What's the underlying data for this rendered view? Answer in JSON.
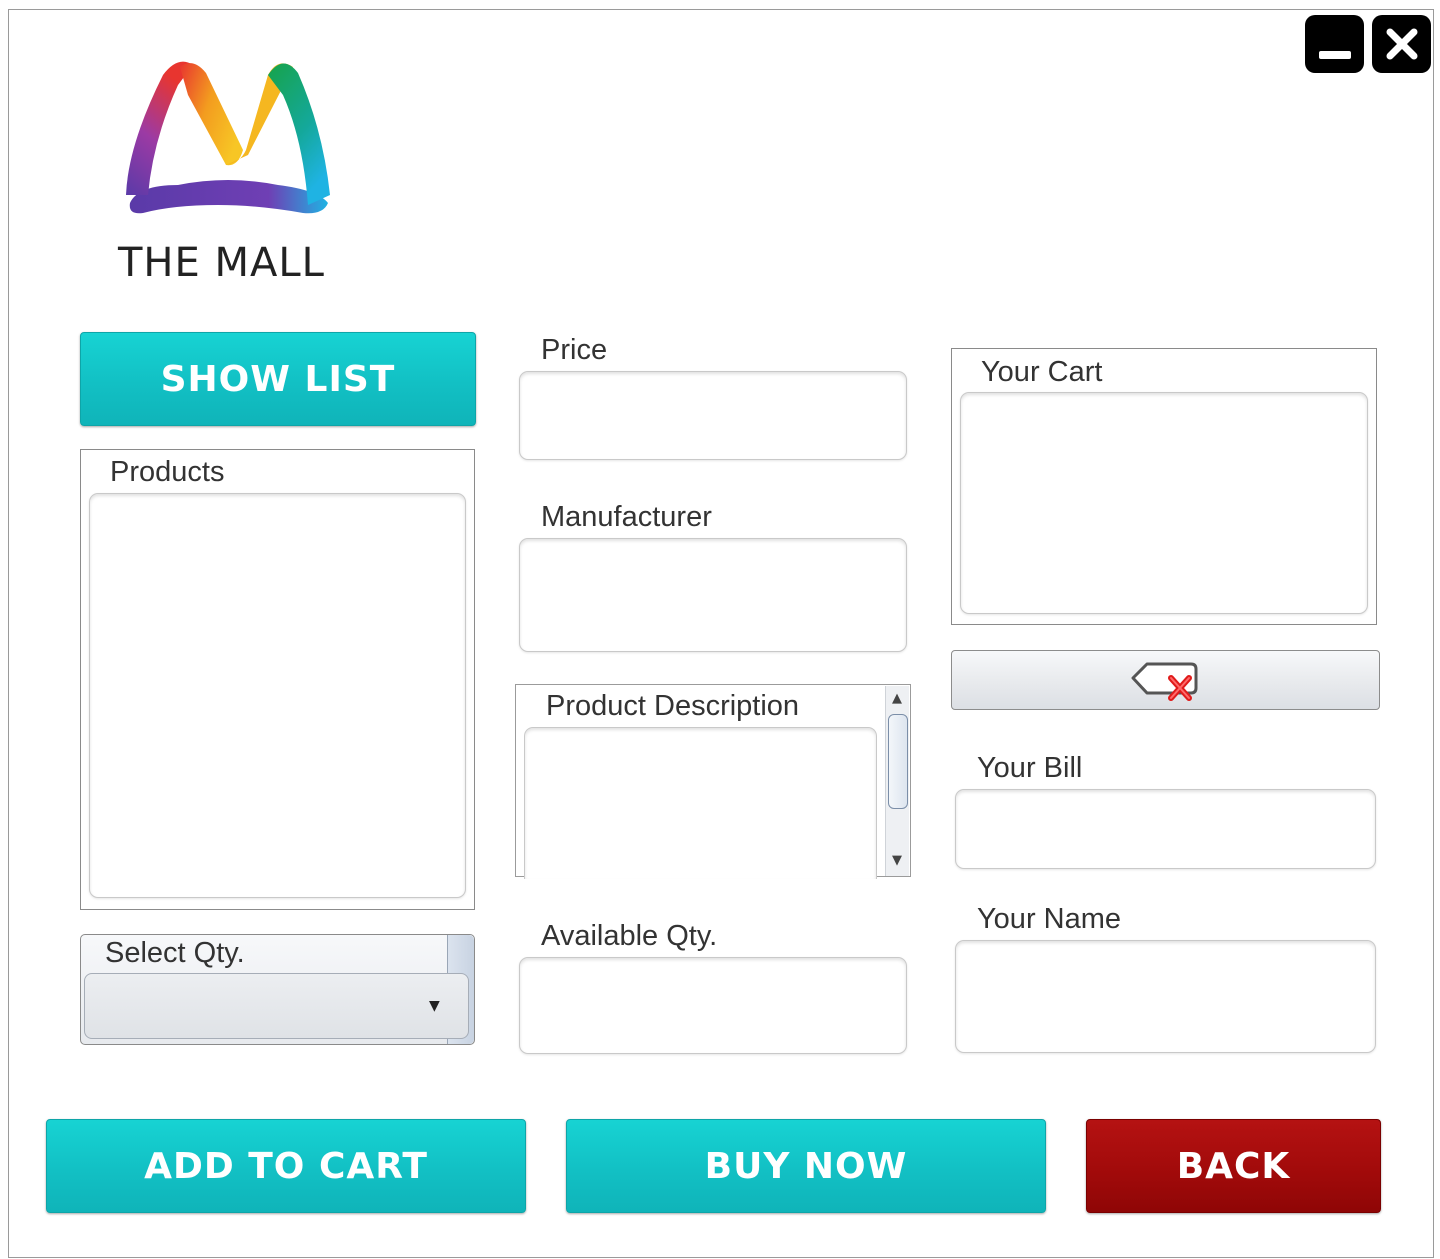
{
  "brand": {
    "name": "THE MALL"
  },
  "window_controls": {
    "minimize_icon": "minimize-icon",
    "close_icon": "close-icon"
  },
  "buttons": {
    "show_list": "SHOW LIST",
    "add_to_cart": "ADD TO CART",
    "buy_now": "BUY NOW",
    "back": "BACK",
    "remove_icon": "backspace-delete-icon"
  },
  "labels": {
    "products": "Products",
    "select_qty": "Select Qty.",
    "price": "Price",
    "manufacturer": "Manufacturer",
    "product_description": "Product Description",
    "available_qty": "Available Qty.",
    "your_cart": "Your Cart",
    "your_bill": "Your Bill",
    "your_name": "Your Name"
  },
  "fields": {
    "price": "",
    "manufacturer": "",
    "available_qty": "",
    "your_bill": "",
    "your_name": "",
    "select_qty_value": ""
  },
  "colors": {
    "teal": "#12c0c4",
    "red": "#a00a0a",
    "logo_gradient": [
      "#6a3fb5",
      "#e8352f",
      "#f7c625",
      "#17a34a",
      "#1fb3e3"
    ]
  }
}
